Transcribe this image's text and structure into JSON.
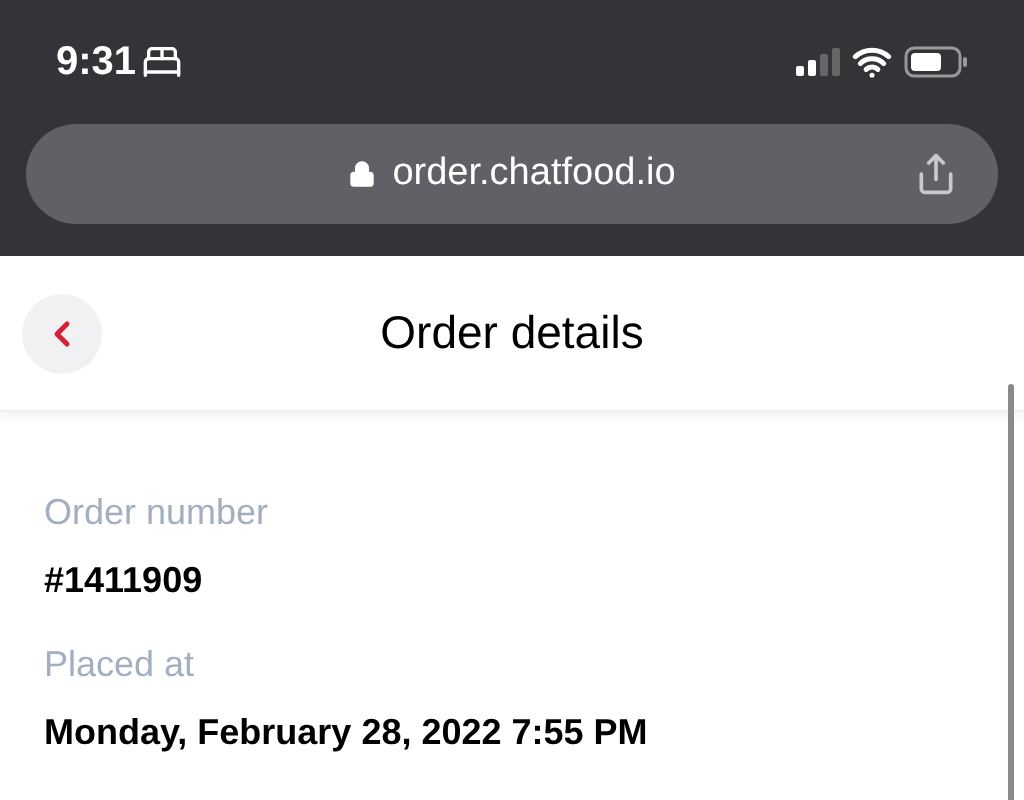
{
  "status_bar": {
    "time": "9:31"
  },
  "address_bar": {
    "url": "order.chatfood.io"
  },
  "header": {
    "title": "Order details"
  },
  "fields": [
    {
      "label": "Order number",
      "value": "#1411909"
    },
    {
      "label": "Placed at",
      "value": "Monday, February 28, 2022 7:55 PM"
    }
  ]
}
